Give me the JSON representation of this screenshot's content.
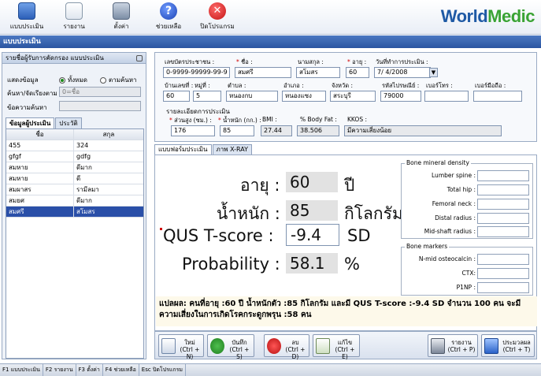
{
  "toolbar": {
    "items": [
      {
        "label": "แบบประเมิน",
        "icon": "form-icon"
      },
      {
        "label": "รายงาน",
        "icon": "report-icon"
      },
      {
        "label": "ตั้งค่า",
        "icon": "settings-icon"
      },
      {
        "label": "ช่วยเหลือ",
        "icon": "help-icon"
      },
      {
        "label": "ปิดโปรแกรม",
        "icon": "close-icon"
      }
    ],
    "brand_main": "World",
    "brand_accent": "Medic"
  },
  "title_bar": "แบบประเมิน",
  "left_panel": {
    "header": "รายชื่อผู้รับการคัดกรอง แบบประเมิน",
    "show_label": "แสดงข้อมูล",
    "radio_all": "ทั้งหมด",
    "radio_by_name": "ตามค้นหา",
    "search_by_label": "ค้นหา/จัดเรียงตาม",
    "search_by_value": "0=ชื่อ",
    "search_text_label": "ข้อความค้นหา",
    "tabs": [
      "ข้อมูลผู้ประเมิน",
      "ประวัติ"
    ],
    "columns": [
      "ชื่อ",
      "สกุล"
    ],
    "rows": [
      [
        "455",
        "324"
      ],
      [
        "gfgf",
        "gdfg"
      ],
      [
        "สมหาย",
        "ดีมาก"
      ],
      [
        "สมหาย",
        "ดี"
      ],
      [
        "สมผาสร",
        "รามีลมา"
      ],
      [
        "สมยศ",
        "ดีมาก"
      ],
      [
        "สมศรี",
        "สโมสร"
      ]
    ],
    "selected_index": 6
  },
  "form": {
    "id_label": "เลขบัตรประชาชน :",
    "id_value": "0-9999-99999-99-9",
    "name_label": "ชื่อ :",
    "name_value": "สมศรี",
    "surname_label": "นามสกุล :",
    "surname_value": "สโมสร",
    "age_label": "อายุ :",
    "age_value": "60",
    "date_label": "วันที่ทำการประเมิน :",
    "date_value": "7/ 4/2008",
    "house_label": "บ้านเลขที่ :",
    "house_value": "60",
    "moo_label": "หมู่ที่ :",
    "moo_value": "5",
    "subdistrict_label": "ตำบล :",
    "subdistrict_value": "หนองกบ",
    "district_label": "อำเภอ :",
    "district_value": "หนองแซง",
    "province_label": "จังหวัด :",
    "province_value": "สระบุรี",
    "postcode_label": "รหัสไปรษณีย์ :",
    "postcode_value": "79000",
    "phone_label": "เบอร์โทร :",
    "mobile_label": "เบอร์มือถือ :",
    "detail_group": "รายละเอียดการประเมิน",
    "height_label": "ส่วนสูง (ซม.) :",
    "height_value": "176",
    "weight_label": "น้ำหนัก (กก.) :",
    "weight_value": "85",
    "bmi_label": "BMI :",
    "bmi_value": "27.44",
    "bodyfat_label": "% Body Fat :",
    "bodyfat_value": "38.506",
    "kkos_label": "KKOS :",
    "kkos_value": "มีความเสี่ยงน้อย"
  },
  "main_tabs": [
    "แบบฟอร์มประเมิน",
    "ภาพ X-RAY"
  ],
  "assessment": {
    "age_label": "อายุ :",
    "age_value": "60",
    "age_unit": "ปี",
    "weight_label": "น้ำหนัก :",
    "weight_value": "85",
    "weight_unit": "กิโลกรัม",
    "qus_label": "QUS T-score :",
    "qus_value": "-9.4",
    "qus_unit": "SD",
    "prob_label": "Probability :",
    "prob_value": "58.1",
    "prob_unit": "%"
  },
  "bone_density": {
    "title": "Bone mineral density",
    "items": [
      "Lumber spine :",
      "Total hip :",
      "Femoral neck :",
      "Distal radius :",
      "Mid-shaft radius :"
    ]
  },
  "bone_markers": {
    "title": "Bone markers",
    "items": [
      "N-mid osteocalcin :",
      "CTX:",
      "P1NP :"
    ]
  },
  "interpretation": "แปลผล: คนที่อายุ :60 ปี น้ำหนักตัว :85 กิโลกรัม และมี QUS T-score :-9.4 SD จำนวน 100 คน จะมีความเสี่ยงในการเกิดโรคกระดูกพรุน :58 คน",
  "actions": {
    "new": "ใหม่\n(Ctrl + N)",
    "save": "บันทึก\n(Ctrl + S)",
    "delete": "ลบ\n(Ctrl + D)",
    "edit": "แก้ไข\n(Ctrl + E)",
    "report": "รายงาน\n(Ctrl + P)",
    "evaluate": "ประมวลผล\n(Ctrl + T)"
  },
  "status_bar": [
    "F1 แบบประเมิน",
    "F2 รายงาน",
    "F3 ตั้งค่า",
    "F4 ช่วยเหลือ",
    "Esc ปิดโปรแกรม"
  ]
}
